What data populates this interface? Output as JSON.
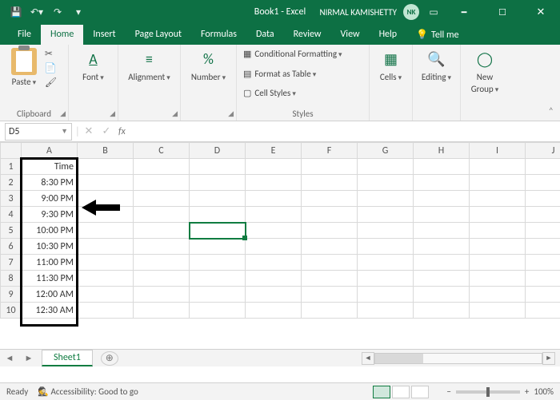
{
  "title": "Book1 - Excel",
  "user": {
    "name": "NIRMAL KAMISHETTY",
    "initials": "NK"
  },
  "tabs": {
    "file": "File",
    "home": "Home",
    "insert": "Insert",
    "pageLayout": "Page Layout",
    "formulas": "Formulas",
    "data": "Data",
    "review": "Review",
    "view": "View",
    "help": "Help",
    "tellme": "Tell me"
  },
  "ribbon": {
    "paste": "Paste",
    "clipboard": "Clipboard",
    "font": "Font",
    "alignment": "Alignment",
    "number": "Number",
    "condFmt": "Conditional Formatting",
    "fmtTable": "Format as Table",
    "cellStyles": "Cell Styles",
    "styles": "Styles",
    "cells": "Cells",
    "editing": "Editing",
    "newGroup": "New",
    "newGroup2": "Group"
  },
  "namebox": "D5",
  "columns": [
    "A",
    "B",
    "C",
    "D",
    "E",
    "F",
    "G",
    "H",
    "I",
    "J"
  ],
  "rows": [
    "1",
    "2",
    "3",
    "4",
    "5",
    "6",
    "7",
    "8",
    "9",
    "10"
  ],
  "colA": {
    "header": "Time",
    "values": [
      "8:30 PM",
      "9:00 PM",
      "9:30 PM",
      "10:00 PM",
      "10:30 PM",
      "11:00 PM",
      "11:30 PM",
      "12:00 AM",
      "12:30 AM"
    ]
  },
  "sheetTab": "Sheet1",
  "status": {
    "ready": "Ready",
    "acc": "Accessibility: Good to go",
    "zoom": "100%"
  }
}
